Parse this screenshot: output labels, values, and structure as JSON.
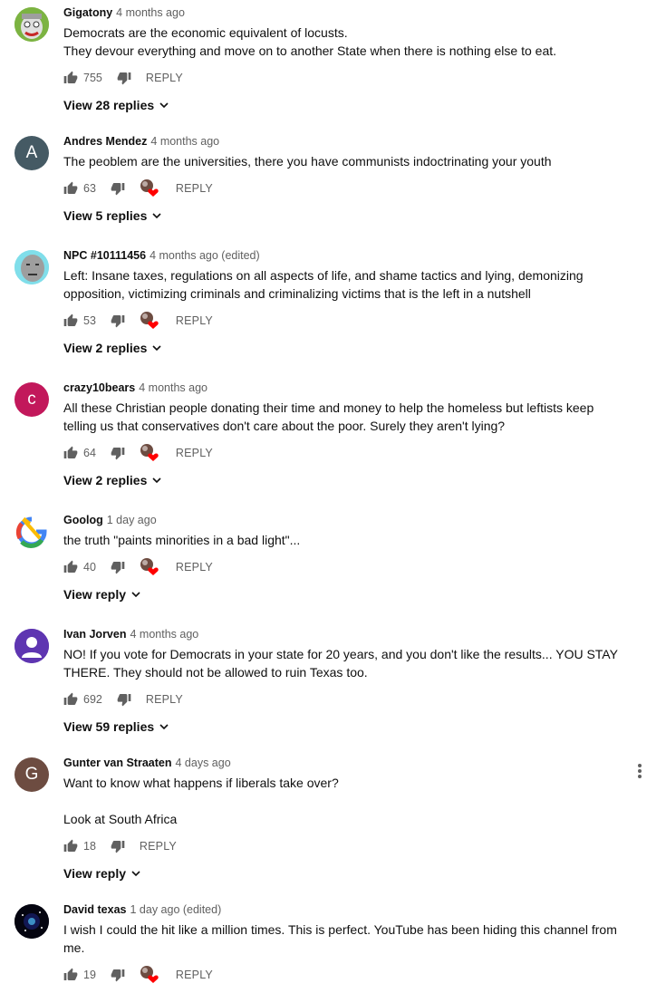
{
  "comments": [
    {
      "author": "Gigatony",
      "time": "4 months ago",
      "lines": [
        "Democrats are the economic equivalent of locusts.",
        "They devour everything and move on to another State when there is nothing else to eat."
      ],
      "likes": "755",
      "reply_label": "REPLY",
      "view_replies": "View 28 replies",
      "hearted": false,
      "avatar_icon": "cartoon-face-avatar"
    },
    {
      "author": "Andres Mendez",
      "time": "4 months ago",
      "lines": [
        "The peoblem are the universities, there you have communists indoctrinating your youth"
      ],
      "likes": "63",
      "reply_label": "REPLY",
      "view_replies": "View 5 replies",
      "hearted": true,
      "avatar_letter": "A",
      "avatar_color": "#455a64"
    },
    {
      "author": "NPC #10111456",
      "time": "4 months ago (edited)",
      "lines": [
        "Left: Insane taxes, regulations on all aspects of life, and shame tactics and lying, demonizing opposition, victimizing criminals and criminalizing victims that is the left in a nutshell"
      ],
      "likes": "53",
      "reply_label": "REPLY",
      "view_replies": "View 2 replies",
      "hearted": true,
      "avatar_icon": "npc-face-avatar"
    },
    {
      "author": "crazy10bears",
      "time": "4 months ago",
      "lines": [
        "All these Christian people donating their time and money to help the homeless but leftists keep telling us that conservatives don't care about the poor. Surely they aren't lying?"
      ],
      "likes": "64",
      "reply_label": "REPLY",
      "view_replies": "View 2 replies",
      "hearted": true,
      "avatar_letter": "c",
      "avatar_color": "#c2185b"
    },
    {
      "author": "Goolog",
      "time": "1 day ago",
      "lines": [
        "the truth \"paints minorities in a bad light\"..."
      ],
      "likes": "40",
      "reply_label": "REPLY",
      "view_replies": "View reply",
      "hearted": true,
      "avatar_icon": "hammer-sickle-logo-avatar"
    },
    {
      "author": "Ivan Jorven",
      "time": "4 months ago",
      "lines": [
        "NO! If you vote for Democrats in your state for 20 years, and you don't like the results... YOU STAY THERE. They should not be allowed to ruin Texas too."
      ],
      "likes": "692",
      "reply_label": "REPLY",
      "view_replies": "View 59 replies",
      "hearted": false,
      "avatar_icon": "default-person-avatar",
      "avatar_color": "#5e35b1"
    },
    {
      "author": "Gunter van Straaten",
      "time": "4 days ago",
      "lines": [
        "Want to know what happens if liberals take over?",
        "",
        "Look at South Africa"
      ],
      "likes": "18",
      "reply_label": "REPLY",
      "view_replies": "View reply",
      "hearted": false,
      "avatar_letter": "G",
      "avatar_color": "#6d4c41"
    },
    {
      "author": "David texas",
      "time": "1 day ago (edited)",
      "lines": [
        "I wish I could the hit like a million times. This is perfect. YouTube has been hiding this channel from me."
      ],
      "likes": "19",
      "reply_label": "REPLY",
      "view_replies": "",
      "hearted": true,
      "avatar_icon": "galaxy-avatar"
    }
  ],
  "colors": {
    "text": "#0f0f0f",
    "secondary": "#606060",
    "heart": "#ff0000"
  }
}
